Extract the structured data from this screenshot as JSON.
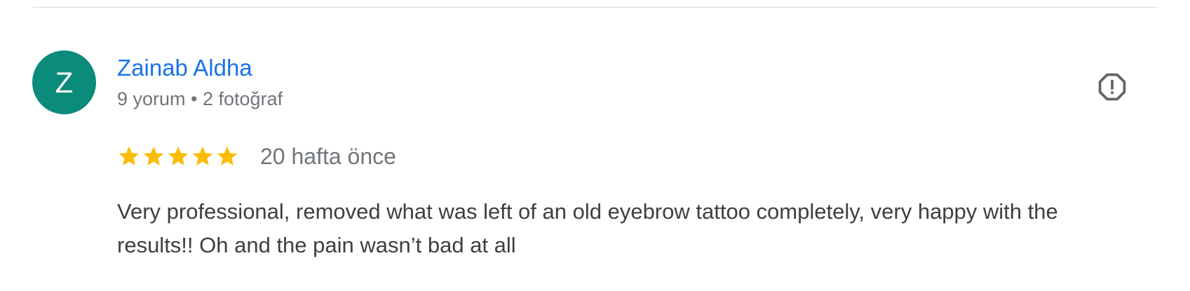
{
  "review": {
    "reviewer": {
      "avatar_letter": "Z",
      "avatar_color": "#0b8b7a",
      "name": "Zainab Aldha",
      "meta": "9 yorum • 2 fotoğraf"
    },
    "report_icon": "report-flag-icon",
    "rating": {
      "stars": 5,
      "max": 5,
      "star_color": "#fbbc04"
    },
    "time": "20 hafta önce",
    "text": "Very professional, removed what was left of an old eyebrow tattoo completely, very happy with the results!! Oh and the pain wasn’t bad at all"
  },
  "colors": {
    "link": "#1a73e8",
    "secondary_text": "#70757a",
    "body_text": "#3c4043",
    "divider": "#dadce0"
  }
}
